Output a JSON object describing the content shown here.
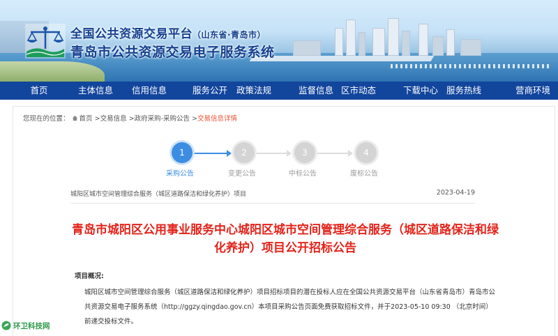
{
  "header": {
    "title_line1": "全国公共资源交易平台",
    "title_line1_region": "（山东省·青岛市）",
    "title_line2": "青岛市公共资源交易电子服务系统",
    "logo_icon": "scales-of-justice-logo-icon"
  },
  "nav": {
    "items": [
      "首页",
      "主体信息",
      "信用信息",
      "服务公开",
      "政策法规",
      "监督信息",
      "区市动态",
      "下载中心",
      "服务热线",
      "营商环境"
    ]
  },
  "breadcrumb": {
    "prefix": "您现在的位置：",
    "items": [
      "首页",
      "交易信息",
      "政府采购-采购公告"
    ],
    "current": "交易信息详情",
    "separator": ">"
  },
  "steps": [
    {
      "number": "1",
      "label": "采购公告",
      "active": true
    },
    {
      "number": "2",
      "label": "变更公告",
      "active": false
    },
    {
      "number": "3",
      "label": "中标公告",
      "active": false
    },
    {
      "number": "4",
      "label": "废标公告",
      "active": false
    }
  ],
  "notice": {
    "project_name": "城阳区城市空间管理综合服务（城区道路保洁和绿化养护）项目",
    "date": "2023-04-19",
    "headline": "青岛市城阳区公用事业服务中心城阳区城市空间管理综合服务（城区道路保洁和绿化养护）项目公开招标公告",
    "section_title": "项目概况:",
    "body": "城阳区城市空间管理综合服务（城区道路保洁和绿化养护）项目招标项目的潜在投标人应在全国公共资源交易平台（山东省青岛市）青岛市公共资源交易电子服务系统（http://ggzy.qingdao.gov.cn）本项目采购公告页面免费获取招标文件，并于2023-05-10 09:30 （北京时间）前递交投标文件。"
  },
  "watermark": {
    "text": "环卫科技网"
  },
  "colors": {
    "nav_bg": "#12459c",
    "active_step": "#3d8de3",
    "headline": "#e3231a",
    "breadcrumb_current": "#e8502e"
  }
}
